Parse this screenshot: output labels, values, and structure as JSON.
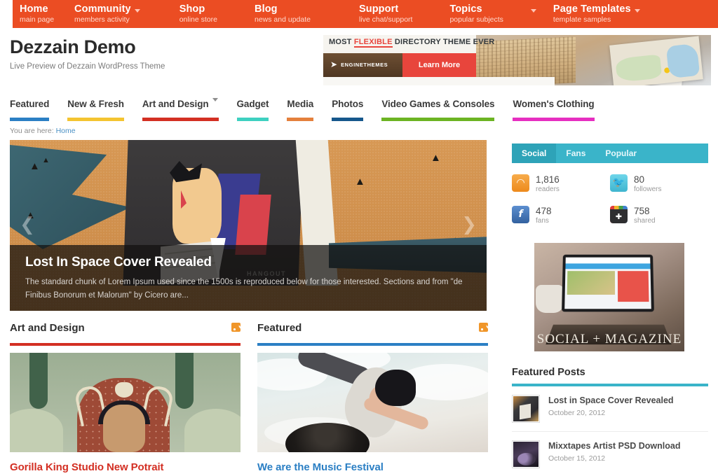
{
  "topnav": {
    "items": [
      {
        "title": "Home",
        "sub": "main page",
        "caret": false
      },
      {
        "title": "Community",
        "sub": "members activity",
        "caret": true
      },
      {
        "title": "Shop",
        "sub": "online store",
        "caret": false
      },
      {
        "title": "Blog",
        "sub": "news and update",
        "caret": false
      },
      {
        "title": "Support",
        "sub": "live chat/support",
        "caret": false
      },
      {
        "title": "Topics",
        "sub": "popular subjects",
        "caret": true
      },
      {
        "title": "Page Templates",
        "sub": "template samples",
        "caret": true
      }
    ],
    "bg_color": "#eb4d23"
  },
  "brand": {
    "title": "Dezzain Demo",
    "tagline": "Live Preview of Dezzain WordPress Theme"
  },
  "header_ad": {
    "headline_before": "MOST ",
    "headline_highlight": "FLEXIBLE",
    "headline_after": " DIRECTORY THEME EVER",
    "logo_text": "ENGINETHEMES",
    "cta_label": "Learn More",
    "highlight_color": "#e8453c"
  },
  "catnav": {
    "items": [
      {
        "label": "Featured",
        "color": "#2b7fc4",
        "caret": false
      },
      {
        "label": "New & Fresh",
        "color": "#f4c430",
        "caret": false
      },
      {
        "label": "Art and Design",
        "color": "#d32f23",
        "caret": true
      },
      {
        "label": "Gadget",
        "color": "#3ed0c0",
        "caret": false
      },
      {
        "label": "Media",
        "color": "#e4803c",
        "caret": false
      },
      {
        "label": "Photos",
        "color": "#16578c",
        "caret": false
      },
      {
        "label": "Video Games & Consoles",
        "color": "#6cb423",
        "caret": false
      },
      {
        "label": "Women's Clothing",
        "color": "#e62ec0",
        "caret": false
      }
    ]
  },
  "breadcrumb": {
    "prefix": "You are here:",
    "link": "Home"
  },
  "slider": {
    "title": "Lost In Space Cover Revealed",
    "excerpt": "The standard chunk of Lorem Ipsum used since the 1500s is reproduced below for those interested. Sections and from \"de Finibus Bonorum et Malorum\" by Cicero are...",
    "image_watermark": "HANGOUT",
    "prev_icon": "chevron-left-icon",
    "next_icon": "chevron-right-icon",
    "prev_glyph": "❮",
    "next_glyph": "❯"
  },
  "columns": [
    {
      "heading": "Art and Design",
      "rule_color": "#d32f23",
      "post_title": "Gorilla King Studio New Potrait",
      "title_color": "#d32f23",
      "rss_icon": "rss-icon"
    },
    {
      "heading": "Featured",
      "rule_color": "#2b7fc4",
      "post_title": "We are the Music Festival",
      "title_color": "#2b7fc4",
      "rss_icon": "rss-icon"
    }
  ],
  "sidebar": {
    "social": {
      "tabs": [
        {
          "label": "Social",
          "active": true
        },
        {
          "label": "Fans",
          "active": false
        },
        {
          "label": "Popular",
          "active": false
        }
      ],
      "accent_color": "#3ab4c9",
      "stats": [
        {
          "icon": "rss-icon",
          "glyph": "◠",
          "color": "#f0922e",
          "count": "1,816",
          "label": "readers"
        },
        {
          "icon": "twitter-icon",
          "glyph": "ᴠ",
          "color": "#4ec3dd",
          "count": "80",
          "label": "followers"
        },
        {
          "icon": "facebook-icon",
          "glyph": "f",
          "color": "#3b6fb6",
          "count": "478",
          "label": "fans"
        },
        {
          "icon": "share-plus-icon",
          "glyph": "✚",
          "color": "#2e2e30",
          "count": "758",
          "label": "shared"
        }
      ]
    },
    "ad": {
      "caption": "SOCIAL + MAGAZINE"
    },
    "featured_posts": {
      "heading": "Featured Posts",
      "rule_color": "#3ab4c9",
      "items": [
        {
          "title": "Lost in Space Cover Revealed",
          "date": "October 20, 2012",
          "thumb": "thumb-lost-in-space"
        },
        {
          "title": "Mixxtapes Artist PSD Download",
          "date": "October 15, 2012",
          "thumb": "thumb-mixxtapes"
        }
      ]
    }
  }
}
